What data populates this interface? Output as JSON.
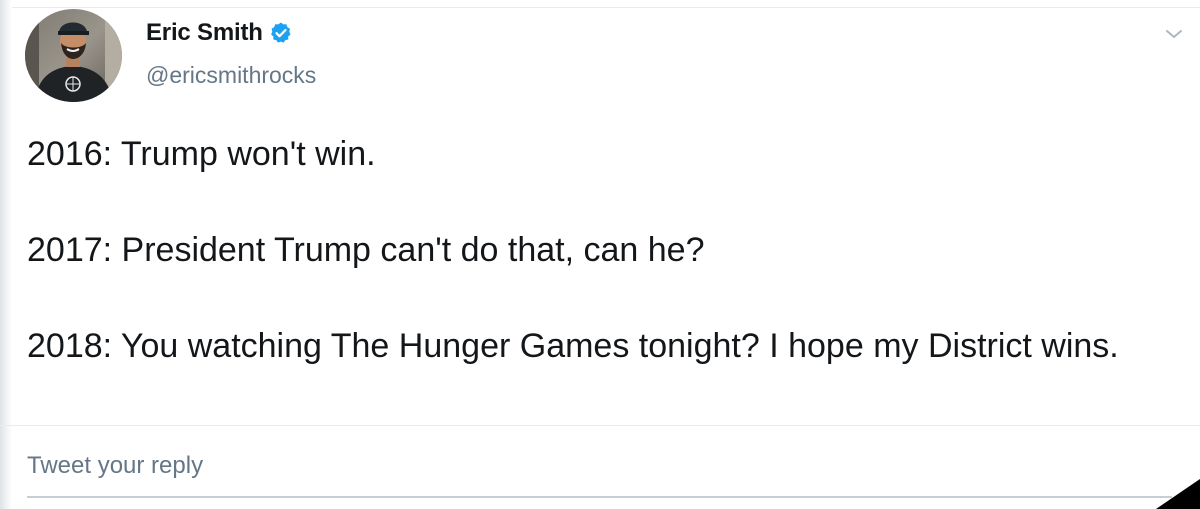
{
  "tweet": {
    "author": {
      "display_name": "Eric Smith",
      "handle": "@ericsmithrocks",
      "verified": true
    },
    "lines": [
      "2016: Trump won't win.",
      "2017: President Trump can't do that, can he?",
      "2018: You watching The Hunger Games tonight? I hope my District wins."
    ]
  },
  "reply": {
    "placeholder": "Tweet your reply"
  },
  "icons": {
    "verified": "verified-badge-icon",
    "more": "chevron-down-icon"
  },
  "colors": {
    "verified_blue": "#1da1f2",
    "text": "#14171a",
    "secondary_text": "#657786",
    "divider": "#e6ecf0"
  }
}
